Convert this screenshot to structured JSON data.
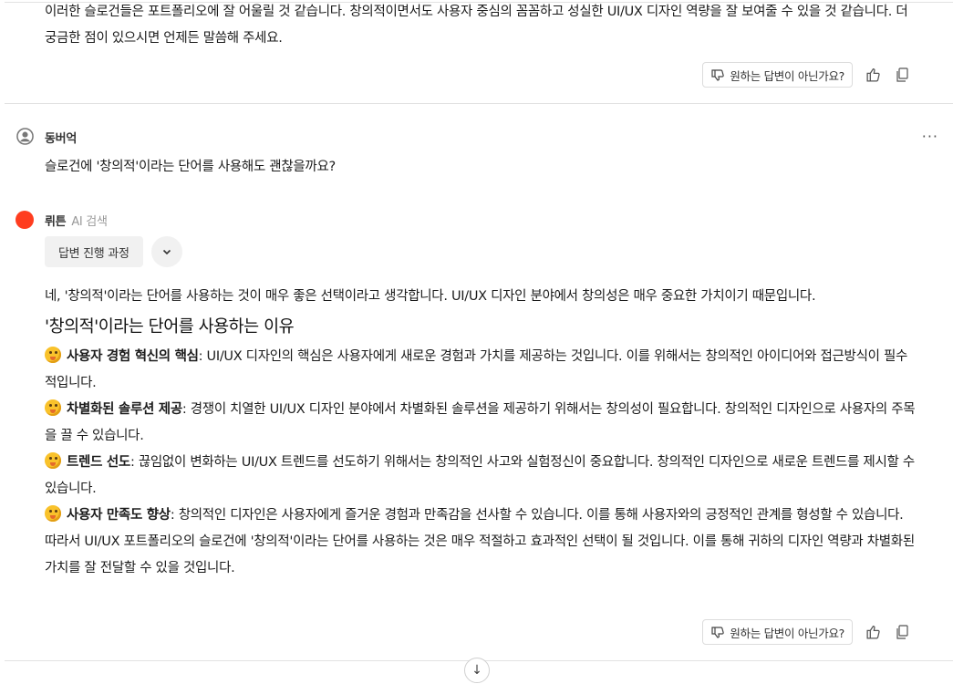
{
  "previous_answer": {
    "text": "이러한 슬로건들은 포트폴리오에 잘 어울릴 것 같습니다. 창의적이면서도 사용자 중심의 꼼꼼하고 성실한 UI/UX 디자인 역량을 잘 보여줄 수 있을 것 같습니다. 더 궁금한 점이 있으시면 언제든 말씀해 주세요.",
    "feedback_label": "원하는 답변이 아닌가요?"
  },
  "user_message": {
    "author": "동버억",
    "text": "슬로건에 '창의적'이라는 단어를 사용해도 괜찮을까요?",
    "more_label": "···"
  },
  "ai_message": {
    "author": "뤼튼",
    "tag": "AI 검색",
    "process_label": "답변 진행 과정",
    "intro": "네, '창의적'이라는 단어를 사용하는 것이 매우 좋은 선택이라고 생각합니다. UI/UX 디자인 분야에서 창의성은 매우 중요한 가치이기 때문입니다.",
    "heading": "'창의적'이라는 단어를 사용하는 이유",
    "reasons": [
      {
        "title": "사용자 경험 혁신의 핵심",
        "text": ": UI/UX 디자인의 핵심은 사용자에게 새로운 경험과 가치를 제공하는 것입니다. 이를 위해서는 창의적인 아이디어와 접근방식이 필수적입니다."
      },
      {
        "title": "차별화된 솔루션 제공",
        "text": ": 경쟁이 치열한 UI/UX 디자인 분야에서 차별화된 솔루션을 제공하기 위해서는 창의성이 필요합니다. 창의적인 디자인으로 사용자의 주목을 끌 수 있습니다."
      },
      {
        "title": "트렌드 선도",
        "text": ": 끊임없이 변화하는 UI/UX 트렌드를 선도하기 위해서는 창의적인 사고와 실험정신이 중요합니다. 창의적인 디자인으로 새로운 트렌드를 제시할 수 있습니다."
      },
      {
        "title": "사용자 만족도 향상",
        "text": ": 창의적인 디자인은 사용자에게 즐거운 경험과 만족감을 선사할 수 있습니다. 이를 통해 사용자와의 긍정적인 관계를 형성할 수 있습니다."
      }
    ],
    "conclusion": "따라서 UI/UX 포트폴리오의 슬로건에 '창의적'이라는 단어를 사용하는 것은 매우 적절하고 효과적인 선택이 될 것입니다. 이를 통해 귀하의 디자인 역량과 차별화된 가치를 잘 전달할 수 있을 것입니다.",
    "feedback_label": "원하는 답변이 아닌가요?"
  },
  "scroll_down_label": "↓"
}
